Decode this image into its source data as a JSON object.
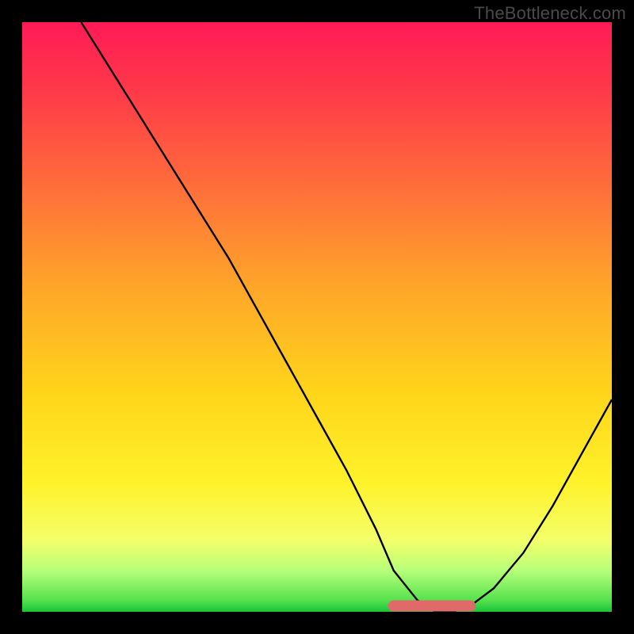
{
  "watermark": "TheBottleneck.com",
  "chart_data": {
    "type": "line",
    "title": "",
    "xlabel": "",
    "ylabel": "",
    "xlim": [
      0,
      100
    ],
    "ylim": [
      0,
      100
    ],
    "series": [
      {
        "name": "bottleneck-curve",
        "x": [
          10,
          15,
          20,
          25,
          30,
          35,
          40,
          45,
          50,
          55,
          60,
          63,
          67,
          70,
          73,
          76,
          80,
          85,
          90,
          95,
          100
        ],
        "values": [
          100,
          92,
          84,
          76,
          68,
          60,
          51,
          42,
          33,
          24,
          14,
          7,
          2,
          0,
          0,
          1,
          4,
          10,
          18,
          27,
          36
        ]
      }
    ],
    "valley": {
      "x_start": 63,
      "x_end": 76,
      "y": 1
    },
    "gradient_colors": {
      "top": "#ff1a56",
      "mid_high": "#ffa629",
      "mid": "#fff22a",
      "low": "#57e24e",
      "bottom": "#18c43a"
    }
  }
}
